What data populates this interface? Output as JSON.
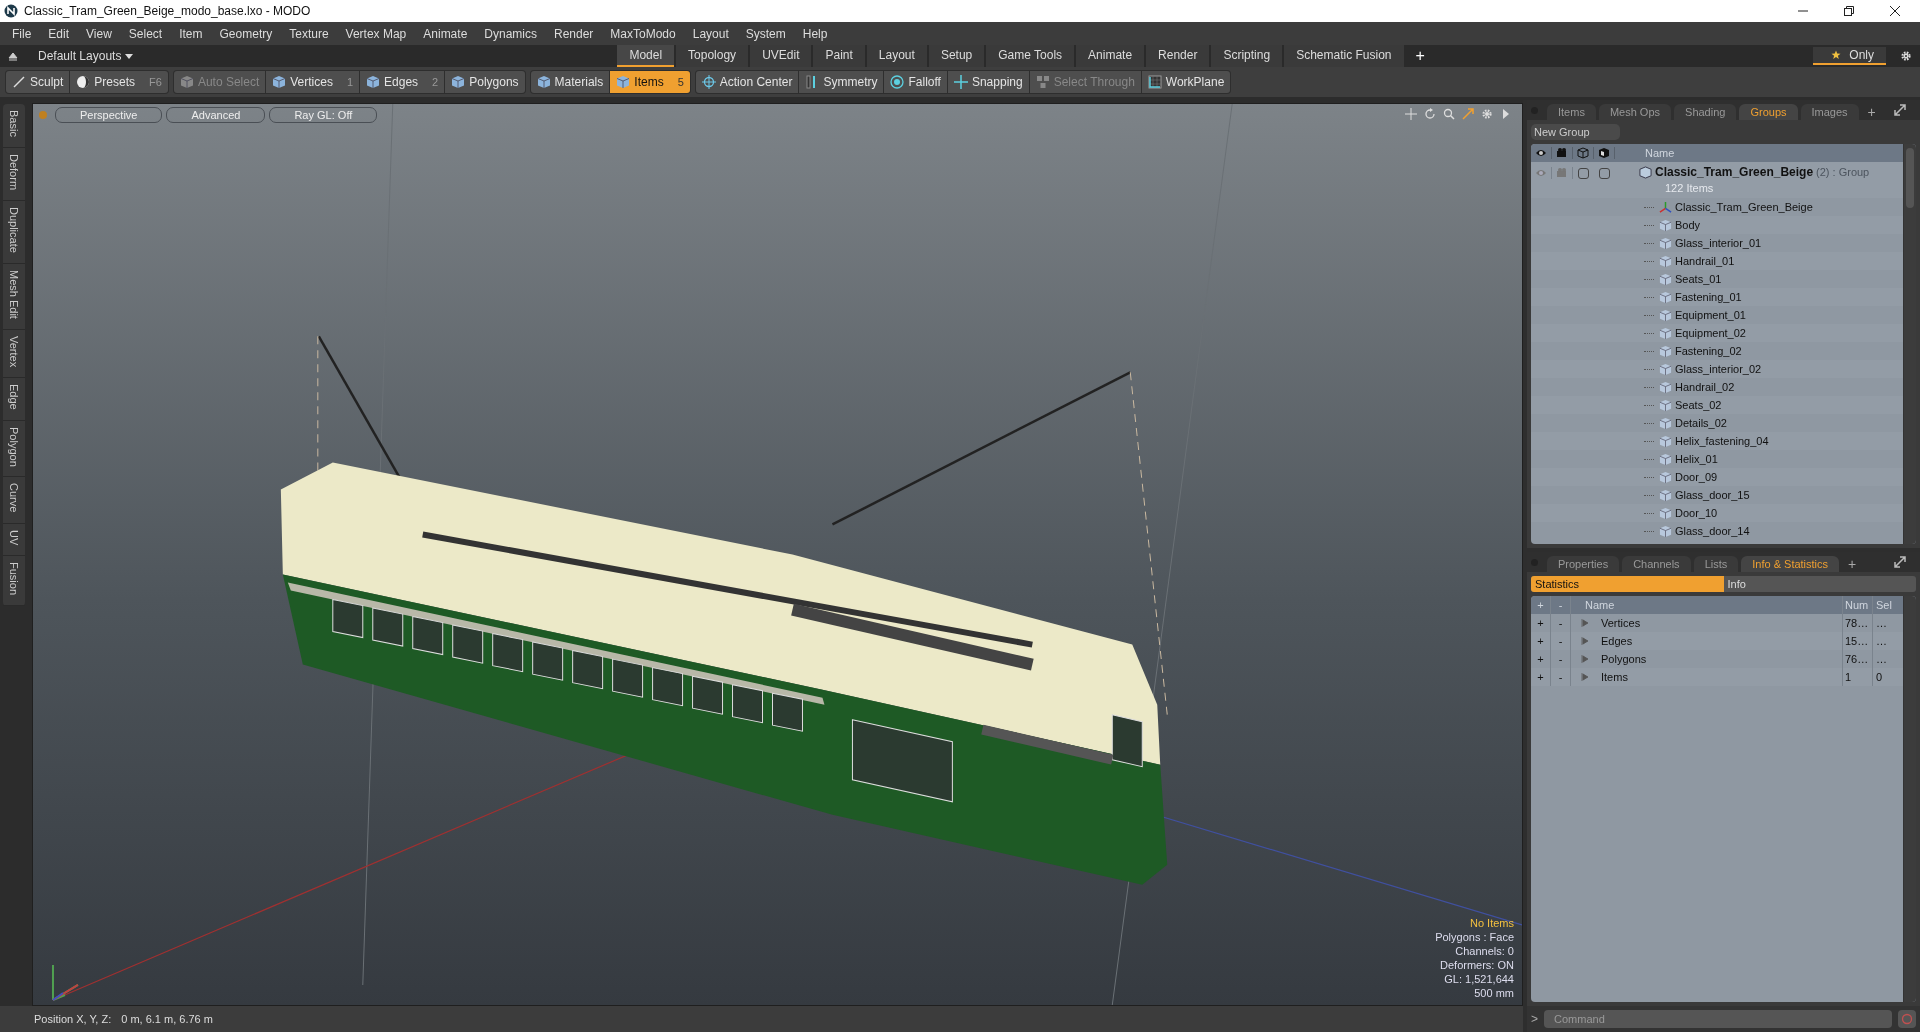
{
  "window": {
    "title": "Classic_Tram_Green_Beige_modo_base.lxo - MODO"
  },
  "menu": [
    "File",
    "Edit",
    "View",
    "Select",
    "Item",
    "Geometry",
    "Texture",
    "Vertex Map",
    "Animate",
    "Dynamics",
    "Render",
    "MaxToModo",
    "Layout",
    "System",
    "Help"
  ],
  "layout_selector": {
    "label": "Default Layouts"
  },
  "layout_tabs": [
    {
      "label": "Model",
      "selected": true
    },
    {
      "label": "Topology",
      "selected": false
    },
    {
      "label": "UVEdit",
      "selected": false
    },
    {
      "label": "Paint",
      "selected": false
    },
    {
      "label": "Layout",
      "selected": false
    },
    {
      "label": "Setup",
      "selected": false
    },
    {
      "label": "Game Tools",
      "selected": false
    },
    {
      "label": "Animate",
      "selected": false
    },
    {
      "label": "Render",
      "selected": false
    },
    {
      "label": "Scripting",
      "selected": false
    },
    {
      "label": "Schematic Fusion",
      "selected": false
    }
  ],
  "layout_add": "+",
  "only_button": {
    "label": "Only"
  },
  "toolbar_groups": [
    [
      {
        "label": "Sculpt",
        "selected": false,
        "disabled": false
      },
      {
        "label": "Presets",
        "shortcut": "F6",
        "selected": false,
        "disabled": false
      }
    ],
    [
      {
        "label": "Auto Select",
        "selected": false,
        "disabled": true
      },
      {
        "label": "Vertices",
        "shortcut": "1",
        "selected": false,
        "disabled": false
      },
      {
        "label": "Edges",
        "shortcut": "2",
        "selected": false,
        "disabled": false
      },
      {
        "label": "Polygons",
        "selected": false,
        "disabled": false
      }
    ],
    [
      {
        "label": "Materials",
        "selected": false,
        "disabled": false
      },
      {
        "label": "Items",
        "shortcut": "5",
        "selected": true,
        "disabled": false
      }
    ],
    [
      {
        "label": "Action Center",
        "selected": false,
        "disabled": false
      },
      {
        "label": "Symmetry",
        "selected": false,
        "disabled": false
      },
      {
        "label": "Falloff",
        "selected": false,
        "disabled": false
      },
      {
        "label": "Snapping",
        "selected": false,
        "disabled": false
      },
      {
        "label": "Select Through",
        "selected": false,
        "disabled": true
      },
      {
        "label": "WorkPlane",
        "selected": false,
        "disabled": false
      }
    ]
  ],
  "side_tabs": [
    "Basic",
    "Deform",
    "Duplicate",
    "Mesh Edit",
    "Vertex",
    "Edge",
    "Polygon",
    "Curve",
    "UV",
    "Fusion"
  ],
  "viewport": {
    "buttons": [
      "Perspective",
      "Advanced",
      "Ray GL: Off"
    ],
    "overlay": [
      {
        "text": "No Items",
        "kind": "highlight"
      },
      {
        "text": "Polygons : Face",
        "kind": "normal"
      },
      {
        "text": "Channels: 0",
        "kind": "normal"
      },
      {
        "text": "Deformers: ON",
        "kind": "normal"
      },
      {
        "text": "GL: 1,521,644",
        "kind": "normal"
      },
      {
        "text": "500 mm",
        "kind": "normal"
      }
    ]
  },
  "status_bar": {
    "label": "Position X, Y, Z:",
    "value": "0 m, 6.1 m, 6.76 m"
  },
  "groups_panel": {
    "tabs": [
      {
        "label": "Items",
        "selected": false
      },
      {
        "label": "Mesh Ops",
        "selected": false
      },
      {
        "label": "Shading",
        "selected": false
      },
      {
        "label": "Groups",
        "selected": true
      },
      {
        "label": "Images",
        "selected": false
      }
    ],
    "add_tab": "+",
    "new_group": "New Group",
    "columns": [
      "Name"
    ],
    "group": {
      "name": "Classic_Tram_Green_Beige",
      "checks": [
        false,
        false
      ],
      "count": "(2)",
      "type": ": Group",
      "items": "122 Items",
      "children": [
        {
          "name": "Classic_Tram_Green_Beige",
          "kind": "locator"
        },
        {
          "name": "Body",
          "kind": "mesh"
        },
        {
          "name": "Glass_interior_01",
          "kind": "mesh"
        },
        {
          "name": "Handrail_01",
          "kind": "mesh"
        },
        {
          "name": "Seats_01",
          "kind": "mesh"
        },
        {
          "name": "Fastening_01",
          "kind": "mesh"
        },
        {
          "name": "Equipment_01",
          "kind": "mesh"
        },
        {
          "name": "Equipment_02",
          "kind": "mesh"
        },
        {
          "name": "Fastening_02",
          "kind": "mesh"
        },
        {
          "name": "Glass_interior_02",
          "kind": "mesh"
        },
        {
          "name": "Handrail_02",
          "kind": "mesh"
        },
        {
          "name": "Seats_02",
          "kind": "mesh"
        },
        {
          "name": "Details_02",
          "kind": "mesh"
        },
        {
          "name": "Helix_fastening_04",
          "kind": "mesh"
        },
        {
          "name": "Helix_01",
          "kind": "mesh"
        },
        {
          "name": "Door_09",
          "kind": "mesh"
        },
        {
          "name": "Glass_door_15",
          "kind": "mesh"
        },
        {
          "name": "Door_10",
          "kind": "mesh"
        },
        {
          "name": "Glass_door_14",
          "kind": "mesh"
        }
      ]
    }
  },
  "stats_panel": {
    "tabs": [
      {
        "label": "Properties",
        "selected": false
      },
      {
        "label": "Channels",
        "selected": false
      },
      {
        "label": "Lists",
        "selected": false
      },
      {
        "label": "Info & Statistics",
        "selected": true
      }
    ],
    "add_tab": "+",
    "subtabs": [
      {
        "label": "Statistics",
        "selected": true
      },
      {
        "label": "Info",
        "selected": false
      }
    ],
    "columns": [
      "+",
      "-",
      "Name",
      "Num",
      "Sel"
    ],
    "rows": [
      {
        "add": "+",
        "remove": "-",
        "name": "Vertices",
        "num": "78…",
        "sel": "…"
      },
      {
        "add": "+",
        "remove": "-",
        "name": "Edges",
        "num": "15…",
        "sel": "…"
      },
      {
        "add": "+",
        "remove": "-",
        "name": "Polygons",
        "num": "76…",
        "sel": "…"
      },
      {
        "add": "+",
        "remove": "-",
        "name": "Items",
        "num": "1",
        "sel": "0"
      }
    ]
  },
  "command": {
    "prompt": ">",
    "placeholder": "Command"
  }
}
